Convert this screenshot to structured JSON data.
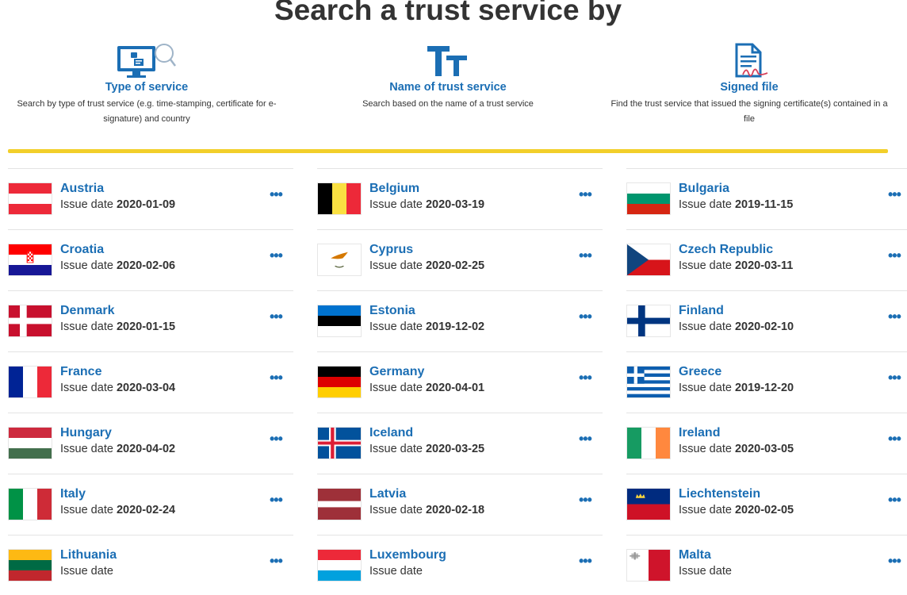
{
  "page_title": "Search a trust service by",
  "search_options": [
    {
      "label": "Type of service",
      "description": "Search by type of trust service (e.g. time-stamping, certificate for e-signature) and country",
      "icon": "monitor-search-icon"
    },
    {
      "label": "Name of trust service",
      "description": "Search based on the name of a trust service",
      "icon": "text-name-icon"
    },
    {
      "label": "Signed file",
      "description": "Find the trust service that issued the signing certificate(s) contained in a file",
      "icon": "signed-document-icon"
    }
  ],
  "issue_date_label": "Issue date",
  "more_icon": "more-options-icon",
  "accent_color": "#1b6eb4",
  "divider_color": "#f2cf2a",
  "countries": [
    {
      "name": "Austria",
      "date": "2020-01-09"
    },
    {
      "name": "Belgium",
      "date": "2020-03-19"
    },
    {
      "name": "Bulgaria",
      "date": "2019-11-15"
    },
    {
      "name": "Croatia",
      "date": "2020-02-06"
    },
    {
      "name": "Cyprus",
      "date": "2020-02-25"
    },
    {
      "name": "Czech Republic",
      "date": "2020-03-11"
    },
    {
      "name": "Denmark",
      "date": "2020-01-15"
    },
    {
      "name": "Estonia",
      "date": "2019-12-02"
    },
    {
      "name": "Finland",
      "date": "2020-02-10"
    },
    {
      "name": "France",
      "date": "2020-03-04"
    },
    {
      "name": "Germany",
      "date": "2020-04-01"
    },
    {
      "name": "Greece",
      "date": "2019-12-20"
    },
    {
      "name": "Hungary",
      "date": "2020-04-02"
    },
    {
      "name": "Iceland",
      "date": "2020-03-25"
    },
    {
      "name": "Ireland",
      "date": "2020-03-05"
    },
    {
      "name": "Italy",
      "date": "2020-02-24"
    },
    {
      "name": "Latvia",
      "date": "2020-02-18"
    },
    {
      "name": "Liechtenstein",
      "date": "2020-02-05"
    },
    {
      "name": "Lithuania",
      "date": ""
    },
    {
      "name": "Luxembourg",
      "date": ""
    },
    {
      "name": "Malta",
      "date": ""
    }
  ]
}
